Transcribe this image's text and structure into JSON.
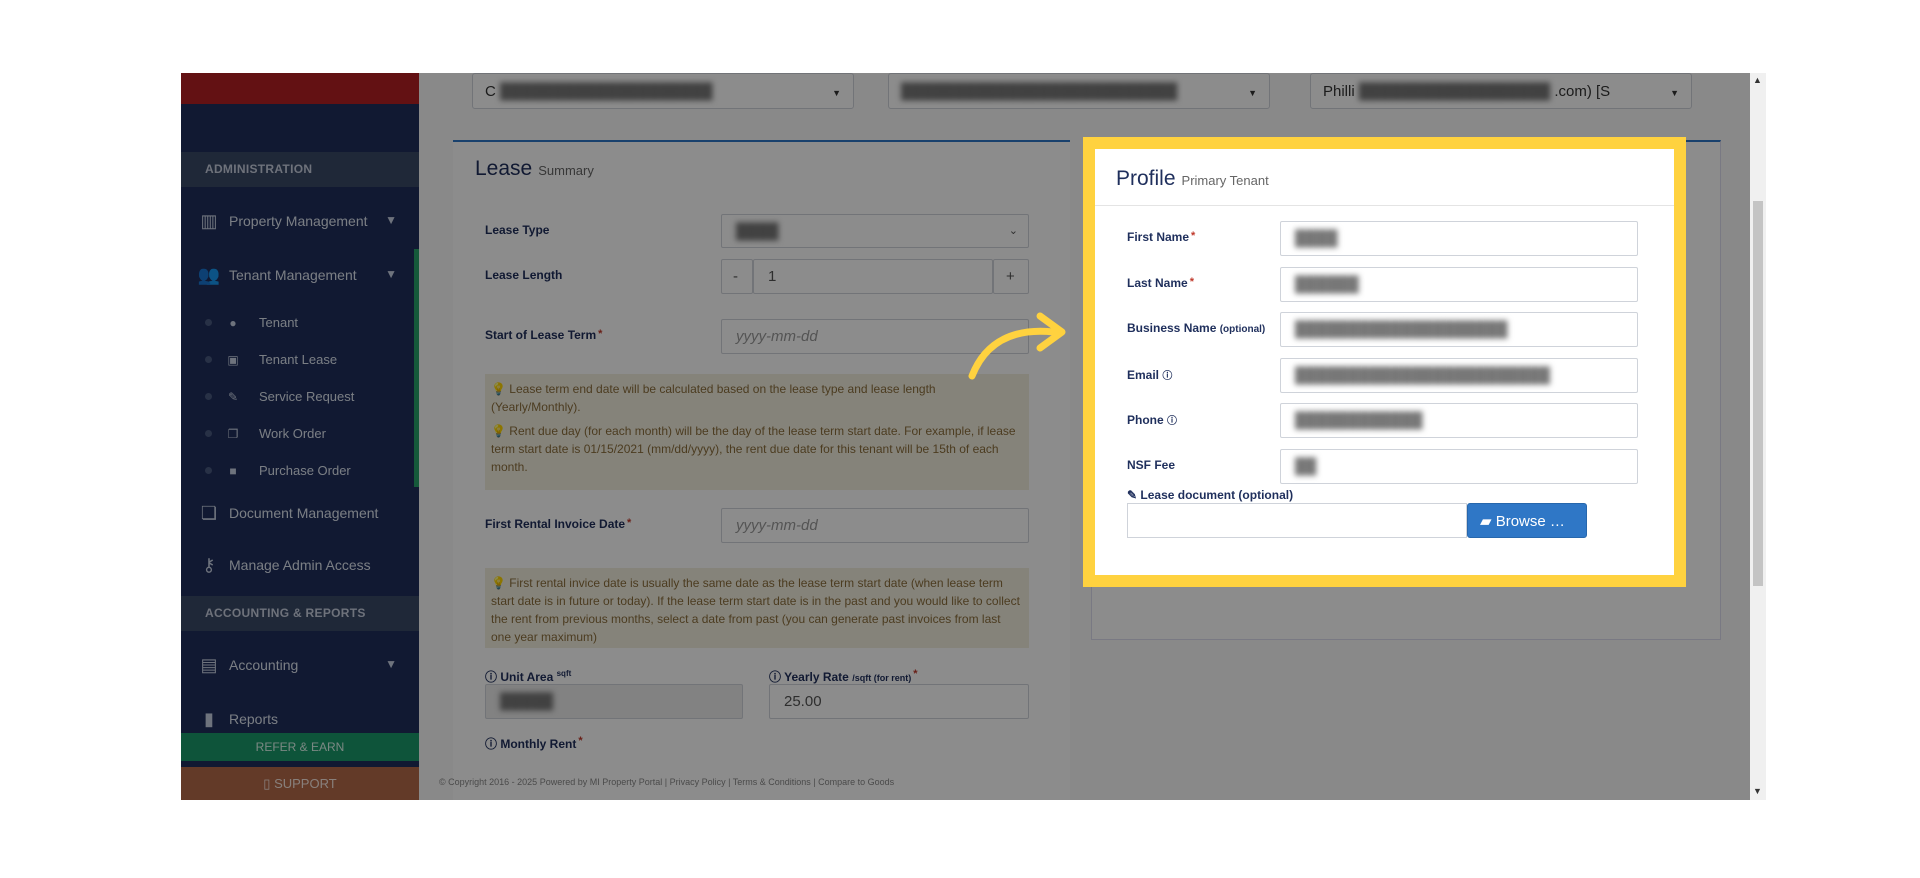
{
  "sidebar": {
    "sections": {
      "administration": "ADMINISTRATION",
      "accounting_reports": "ACCOUNTING & REPORTS"
    },
    "items": {
      "property_management": "Property Management",
      "tenant_management": "Tenant Management",
      "document_management": "Document Management",
      "manage_admin_access": "Manage Admin Access",
      "accounting": "Accounting",
      "reports": "Reports"
    },
    "sub_items": {
      "tenant": "Tenant",
      "tenant_lease": "Tenant Lease",
      "service_request": "Service Request",
      "work_order": "Work Order",
      "purchase_order": "Purchase Order"
    },
    "refer": "REFER & EARN",
    "support": "SUPPORT"
  },
  "top_selects": {
    "first": "C",
    "third_prefix": "Philli",
    "third_suffix": ".com) [S"
  },
  "lease": {
    "title": "Lease",
    "subtitle": "Summary",
    "lease_type_label": "Lease Type",
    "lease_length_label": "Lease Length",
    "lease_length_value": "1",
    "minus": "-",
    "plus": "+",
    "start_label": "Start of Lease Term",
    "start_placeholder": "yyyy-mm-dd",
    "note1_line1": "Lease term end date will be calculated based on the lease type and lease length (Yearly/Monthly).",
    "note1_line2": "Rent due day (for each month) will be the day of the lease term start date. For example, if lease term start date is 01/15/2021 (mm/dd/yyyy), the rent due date for this tenant will be 15th of each month.",
    "first_invoice_label": "First Rental Invoice Date",
    "first_invoice_placeholder": "yyyy-mm-dd",
    "note2": "First rental invice date is usually the same date as the lease term start date (when lease term start date is in future or today). If the lease term start date is in the past and you would like to collect the rent from previous months, select a date from past (you can generate past invoices from last one year maximum)",
    "unit_area_label": "Unit Area",
    "unit_area_unit": "sqft",
    "yearly_rate_label": "Yearly Rate",
    "yearly_rate_unit": "/sqft (for rent)",
    "yearly_rate_value": "25.00",
    "monthly_rent_label": "Monthly Rent"
  },
  "profile": {
    "title": "Profile",
    "subtitle": "Primary Tenant",
    "first_name_label": "First Name",
    "last_name_label": "Last Name",
    "business_name_label": "Business Name",
    "business_name_hint": "(optional)",
    "email_label": "Email",
    "phone_label": "Phone",
    "nsf_fee_label": "NSF Fee",
    "lease_doc_label": "Lease document (optional)",
    "browse_label": "Browse …"
  },
  "footer": "© Copyright 2016 - 2025 Powered by MI Property Portal | Privacy Policy | Terms & Conditions | Compare to Goods",
  "icons": {
    "building": "building-icon",
    "users": "users-icon",
    "user": "user-icon",
    "calendar": "calendar-icon",
    "wrench": "wrench-icon",
    "copy": "copy-icon",
    "truck": "truck-icon",
    "documents": "documents-icon",
    "key": "key-icon",
    "money": "money-icon",
    "bar_chart": "bar-chart-icon",
    "folder": "folder-open-icon",
    "question": "question-circle-icon",
    "info": "info-circle-icon",
    "lightbulb": "lightbulb-icon",
    "paperclip": "paperclip-icon"
  },
  "colors": {
    "sidebar": "#1f2f5c",
    "highlight": "#ffd23f",
    "primary": "#2f77c6",
    "refer": "#1a9a6a",
    "support": "#b46a4a",
    "brand_red": "#b41f24"
  }
}
